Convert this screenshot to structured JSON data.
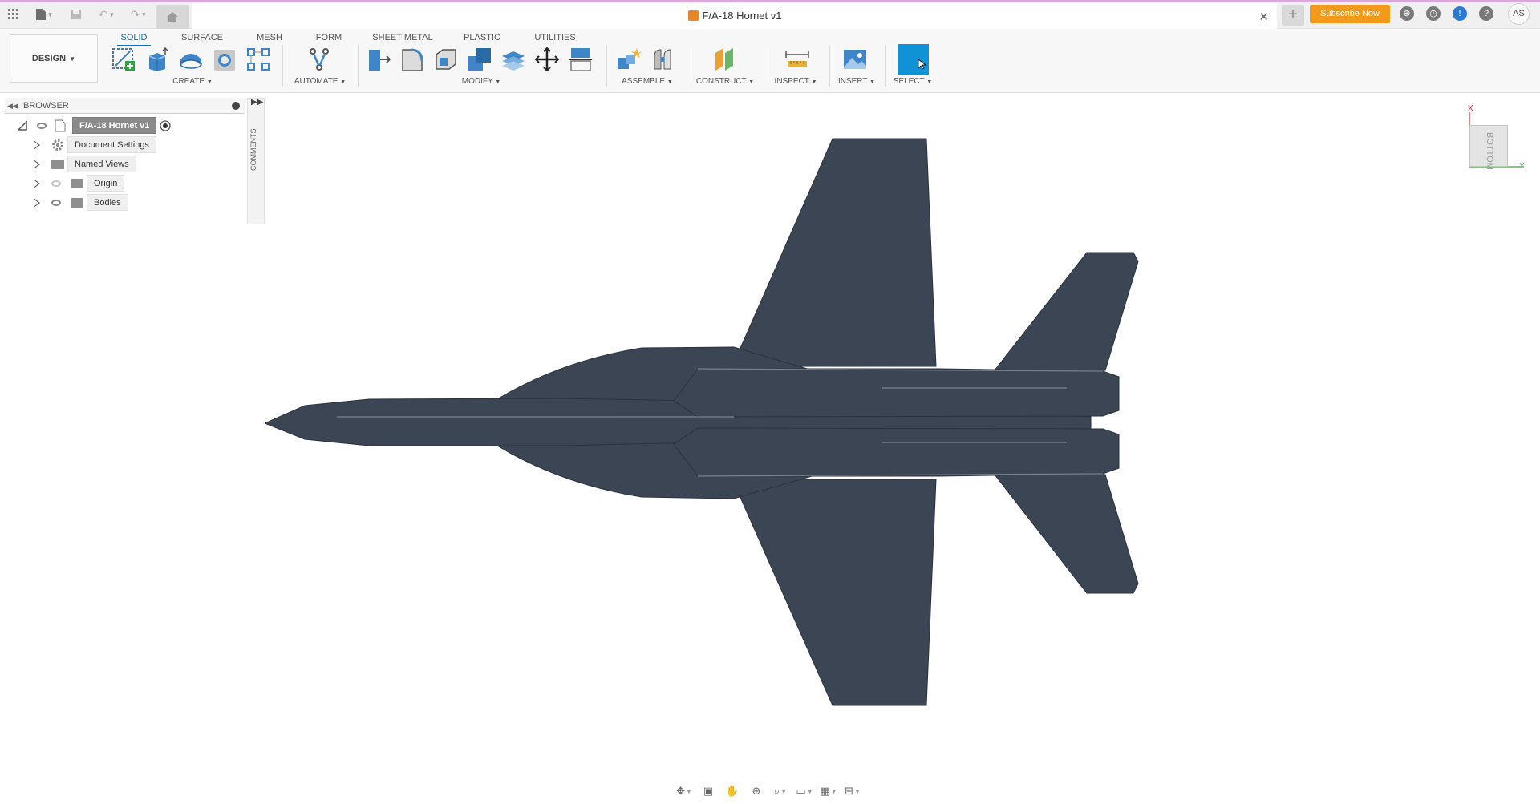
{
  "window": {
    "document_title": "F/A-18 Hornet v1",
    "subscribe_label": "Subscribe Now",
    "avatar_initials": "AS",
    "accent_color": "#0a74b8",
    "subscribe_color": "#f39a1b"
  },
  "icons": {
    "apps": "grid-apps-icon",
    "file": "file-icon",
    "save": "save-icon",
    "undo": "undo-icon",
    "redo": "redo-icon",
    "home": "home-icon",
    "close": "close-icon",
    "new_tab": "plus-icon",
    "extensions": "extensions-icon",
    "job_status": "clock-icon",
    "notifications": "bell-icon",
    "help": "help-icon"
  },
  "toolbar": {
    "workspace_label": "DESIGN",
    "tabs": [
      {
        "label": "SOLID",
        "active": true
      },
      {
        "label": "SURFACE",
        "active": false
      },
      {
        "label": "MESH",
        "active": false
      },
      {
        "label": "FORM",
        "active": false
      },
      {
        "label": "SHEET METAL",
        "active": false
      },
      {
        "label": "PLASTIC",
        "active": false
      },
      {
        "label": "UTILITIES",
        "active": false
      }
    ],
    "groups": {
      "create": "CREATE",
      "automate": "AUTOMATE",
      "modify": "MODIFY",
      "assemble": "ASSEMBLE",
      "construct": "CONSTRUCT",
      "inspect": "INSPECT",
      "insert": "INSERT",
      "select": "SELECT"
    }
  },
  "browser": {
    "title": "BROWSER",
    "root": "F/A-18 Hornet v1",
    "items": [
      {
        "label": "Document Settings",
        "icon": "gear-icon"
      },
      {
        "label": "Named Views",
        "icon": "folder-icon"
      },
      {
        "label": "Origin",
        "icon": "folder-icon",
        "visible": false
      },
      {
        "label": "Bodies",
        "icon": "folder-icon",
        "visible": true
      }
    ]
  },
  "comments": {
    "label": "COMMENTS"
  },
  "viewcube": {
    "face": "BOTTOM",
    "x_axis": "X",
    "y_axis": "Y"
  },
  "model": {
    "body_color": "#3b4554"
  }
}
